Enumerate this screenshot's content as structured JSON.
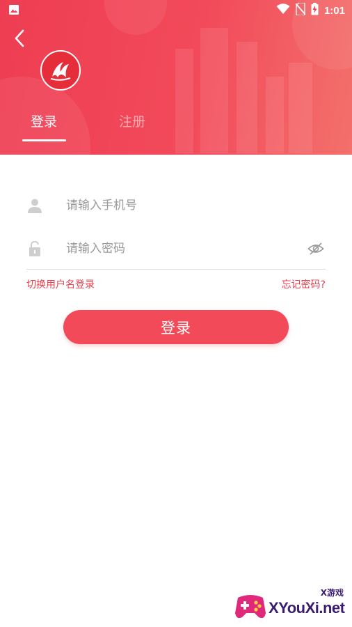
{
  "status_bar": {
    "time": "1:01"
  },
  "tabs": [
    {
      "label": "登录",
      "active": true
    },
    {
      "label": "注册",
      "active": false
    }
  ],
  "form": {
    "phone": {
      "placeholder": "请输入手机号",
      "value": ""
    },
    "password": {
      "placeholder": "请输入密码",
      "value": ""
    }
  },
  "links": {
    "switch_username": "切换用户名登录",
    "forgot_password": "忘记密码?"
  },
  "login_button": "登录",
  "watermark": {
    "main": "XYouXi.net",
    "small": "X游戏"
  },
  "colors": {
    "brand": "#f24a58",
    "link": "#e8404d"
  }
}
